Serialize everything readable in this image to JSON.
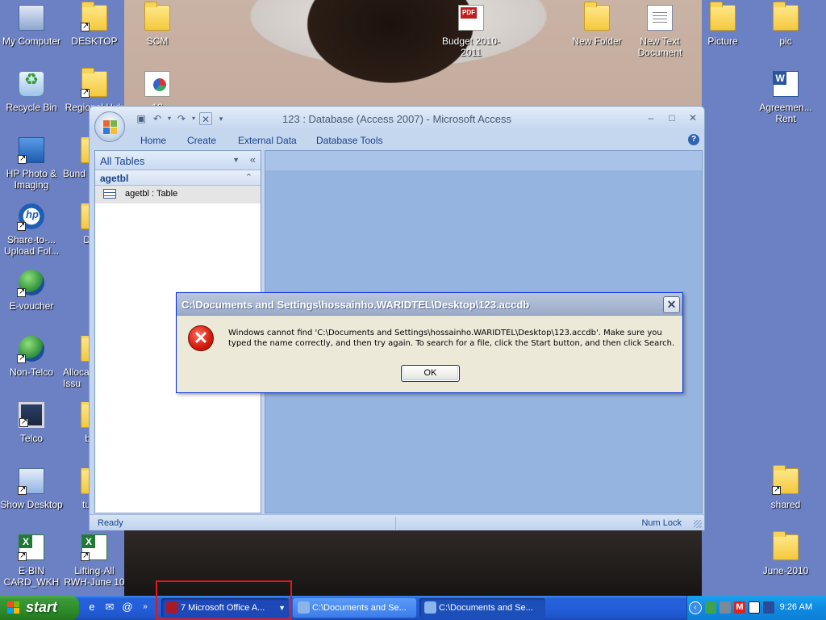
{
  "desktop": {
    "icons": [
      {
        "label": "My Computer",
        "icon": "my-computer-icon"
      },
      {
        "label": "DESKTOP",
        "icon": "folder-icon"
      },
      {
        "label": "SCM",
        "icon": "folder-icon"
      },
      {
        "label": "Budget 2010-2011",
        "icon": "pdf-icon"
      },
      {
        "label": "New Folder",
        "icon": "folder-icon"
      },
      {
        "label": "New Text Document",
        "icon": "text-document-icon"
      },
      {
        "label": "Picture",
        "icon": "folder-icon"
      },
      {
        "label": "pic",
        "icon": "folder-icon"
      },
      {
        "label": "Recycle Bin",
        "icon": "recycle-bin-icon"
      },
      {
        "label": "Regional Hub Kh",
        "icon": "folder-icon"
      },
      {
        "label": "12",
        "icon": "chart-file-icon"
      },
      {
        "label": "Agreemen... Rent",
        "icon": "word-icon"
      },
      {
        "label": "HP Photo & Imaging",
        "icon": "hp-photo-icon"
      },
      {
        "label": "Bund",
        "icon": "folder-icon"
      },
      {
        "label": "Share-to-... Upload Fol...",
        "icon": "hp-share-icon"
      },
      {
        "label": "D",
        "icon": "folder-icon"
      },
      {
        "label": "E-voucher",
        "icon": "globe-icon"
      },
      {
        "label": "Non-Telco",
        "icon": "globe-network-icon"
      },
      {
        "label": "Alloca Issu",
        "icon": "folder-icon"
      },
      {
        "label": "Telco",
        "icon": "monitor-icon"
      },
      {
        "label": "b",
        "icon": "folder-icon"
      },
      {
        "label": "Show Desktop",
        "icon": "show-desktop-icon"
      },
      {
        "label": "tu",
        "icon": "folder-icon"
      },
      {
        "label": "shared",
        "icon": "folder-icon"
      },
      {
        "label": "E-BIN CARD_WKH",
        "icon": "excel-icon"
      },
      {
        "label": "Lifting-All RWH-June 10",
        "icon": "excel-icon"
      },
      {
        "label": "June-2010",
        "icon": "folder-icon"
      }
    ]
  },
  "access_window": {
    "title": "123 : Database (Access 2007) - Microsoft Access",
    "ribbon_tabs": [
      "Home",
      "Create",
      "External Data",
      "Database Tools"
    ],
    "nav_pane": {
      "header": "All Tables",
      "group": "agetbl",
      "item": "agetbl : Table"
    },
    "status": {
      "left": "Ready",
      "right": "Num Lock"
    }
  },
  "dialog": {
    "title": "C:\\Documents and Settings\\hossainho.WARIDTEL\\Desktop\\123.accdb",
    "message": "Windows cannot find 'C:\\Documents and Settings\\hossainho.WARIDTEL\\Desktop\\123.accdb'. Make sure you typed the name correctly, and then try again. To search for a file, click the Start button, and then click Search.",
    "ok_label": "OK"
  },
  "taskbar": {
    "start_label": "start",
    "tasks": [
      "7 Microsoft Office A...",
      "C:\\Documents and Se...",
      "C:\\Documents and Se..."
    ],
    "clock": "9:26 AM"
  }
}
